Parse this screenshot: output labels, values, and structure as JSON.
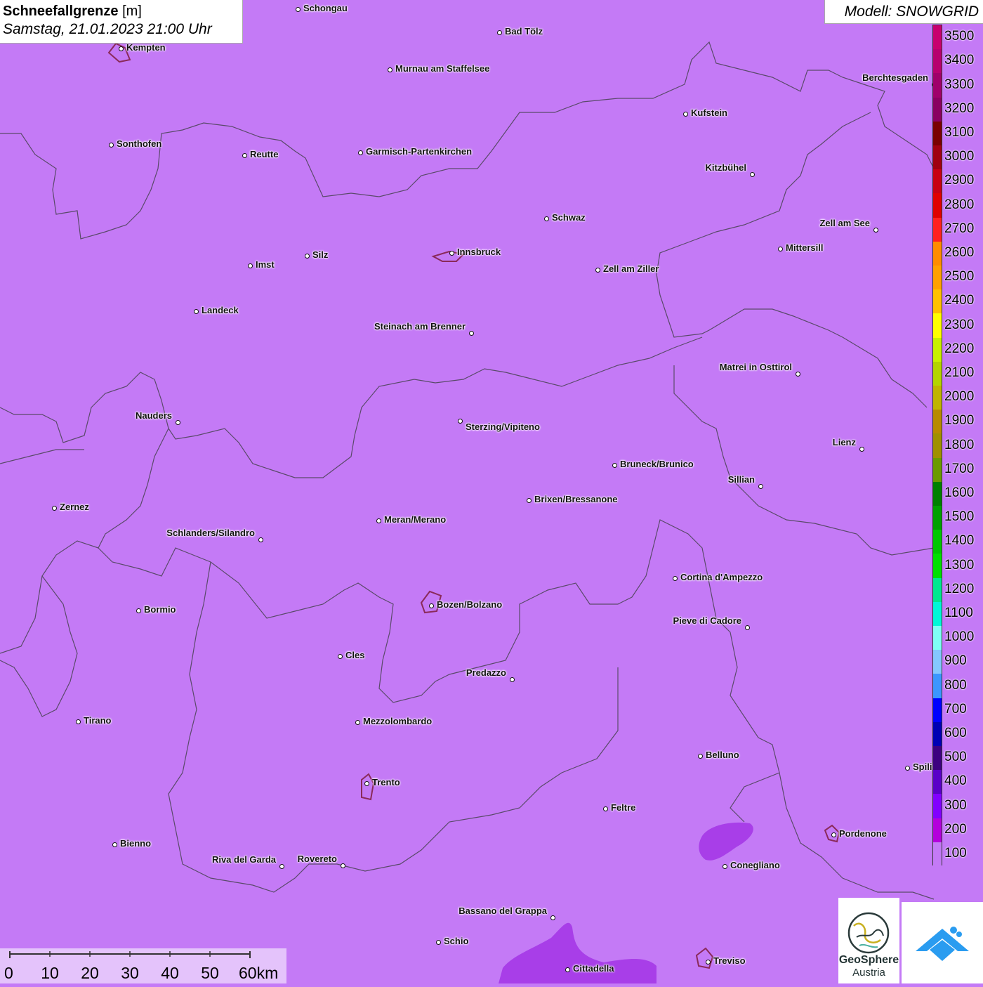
{
  "title": {
    "variable": "Schneefallgrenze",
    "unit": "[m]",
    "datetime": "Samstag, 21.01.2023 21:00 Uhr"
  },
  "model_label": "Modell: SNOWGRID",
  "legend": {
    "levels": [
      "3500",
      "3400",
      "3300",
      "3200",
      "3100",
      "3000",
      "2900",
      "2800",
      "2700",
      "2600",
      "2500",
      "2400",
      "2300",
      "2200",
      "2100",
      "2000",
      "1900",
      "1800",
      "1700",
      "1600",
      "1500",
      "1400",
      "1300",
      "1200",
      "1100",
      "1000",
      "900",
      "800",
      "700",
      "600",
      "500",
      "400",
      "300",
      "200",
      "100"
    ],
    "colors": [
      "#c8006f",
      "#b7006e",
      "#a0006a",
      "#8a0060",
      "#7a0000",
      "#a00010",
      "#c80012",
      "#e00000",
      "#ff2020",
      "#ff8c00",
      "#ffa000",
      "#ffc000",
      "#ffff00",
      "#c8f000",
      "#b4d400",
      "#c0b400",
      "#b88a00",
      "#a09000",
      "#6a9a00",
      "#008000",
      "#00a000",
      "#00c800",
      "#00e000",
      "#00e890",
      "#00f8d8",
      "#7ffff6",
      "#84c8ff",
      "#3c96ff",
      "#0000ff",
      "#0000b4",
      "#3c0080",
      "#5a00c8",
      "#8200ff",
      "#b400dc",
      "#c47af6"
    ]
  },
  "cities": [
    {
      "name": "Schongau"
    },
    {
      "name": "Bad Tölz"
    },
    {
      "name": "Kempten"
    },
    {
      "name": "Murnau am Staffelsee"
    },
    {
      "name": "Berchtesgaden"
    },
    {
      "name": "Kufstein"
    },
    {
      "name": "Sonthofen"
    },
    {
      "name": "Reutte"
    },
    {
      "name": "Garmisch-Partenkirchen"
    },
    {
      "name": "Kitzbühel"
    },
    {
      "name": "Schwaz"
    },
    {
      "name": "Zell am See"
    },
    {
      "name": "Innsbruck"
    },
    {
      "name": "Mittersill"
    },
    {
      "name": "Imst"
    },
    {
      "name": "Silz"
    },
    {
      "name": "Zell am Ziller"
    },
    {
      "name": "Landeck"
    },
    {
      "name": "Steinach am Brenner"
    },
    {
      "name": "Matrei in Osttirol"
    },
    {
      "name": "Nauders"
    },
    {
      "name": "Sterzing/Vipiteno"
    },
    {
      "name": "Lienz"
    },
    {
      "name": "Bruneck/Brunico"
    },
    {
      "name": "Sillian"
    },
    {
      "name": "Zernez"
    },
    {
      "name": "Brixen/Bressanone"
    },
    {
      "name": "Meran/Merano"
    },
    {
      "name": "Schlanders/Silandro"
    },
    {
      "name": "Cortina d'Ampezzo"
    },
    {
      "name": "Bozen/Bolzano"
    },
    {
      "name": "Bormio"
    },
    {
      "name": "Pieve di Cadore"
    },
    {
      "name": "Cles"
    },
    {
      "name": "Predazzo"
    },
    {
      "name": "Tirano"
    },
    {
      "name": "Mezzolombardo"
    },
    {
      "name": "Belluno"
    },
    {
      "name": "Spili"
    },
    {
      "name": "Trento"
    },
    {
      "name": "Feltre"
    },
    {
      "name": "Pordenone"
    },
    {
      "name": "Bienno"
    },
    {
      "name": "Riva del Garda"
    },
    {
      "name": "Rovereto"
    },
    {
      "name": "Conegliano"
    },
    {
      "name": "Bassano del Grappa"
    },
    {
      "name": "Schio"
    },
    {
      "name": "Treviso"
    },
    {
      "name": "Cittadella"
    }
  ],
  "scale": {
    "labels": [
      "0",
      "10",
      "20",
      "30",
      "40",
      "50",
      "60km"
    ]
  },
  "logos": {
    "geosphere_line1": "GeoSphere",
    "geosphere_line2": "Austria"
  }
}
